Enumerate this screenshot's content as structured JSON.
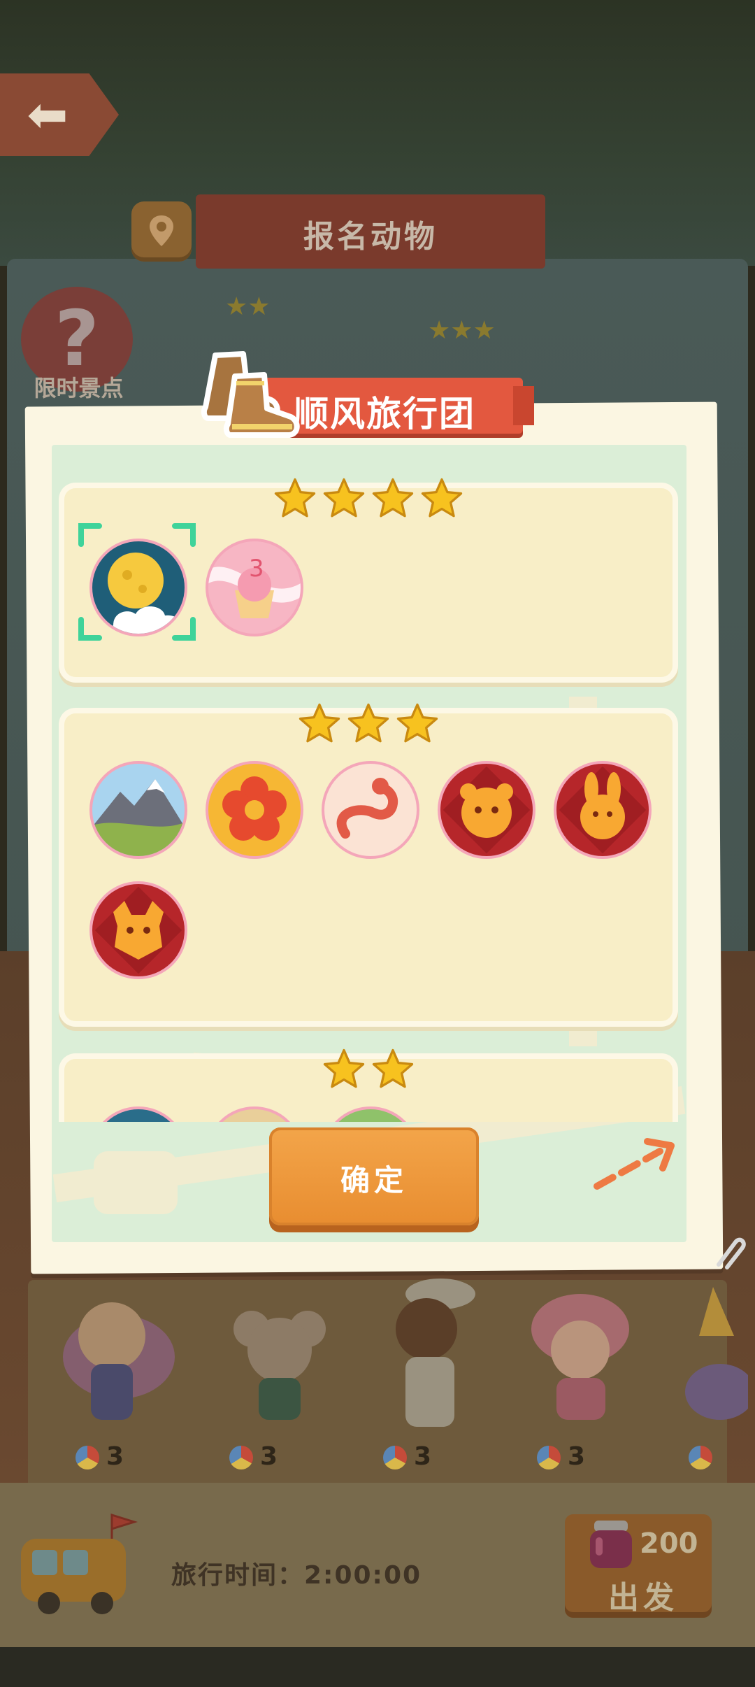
{
  "header": {
    "title": "报名动物"
  },
  "limited_spot": {
    "label": "限时景点"
  },
  "modal": {
    "title": "顺风旅行团",
    "confirm_label": "确定",
    "groups": [
      {
        "stars": 4,
        "spots": [
          "moon-night",
          "cupcake-swirl"
        ]
      },
      {
        "stars": 3,
        "spots": [
          "mountain-meadow",
          "plum-blossom",
          "snake-swirl",
          "tiger-newyear",
          "rabbit-newyear",
          "dragon-newyear"
        ]
      },
      {
        "stars": 2,
        "spots": [
          "partial-spot-1",
          "partial-spot-2",
          "partial-spot-3"
        ]
      }
    ]
  },
  "characters": [
    {
      "name_icon": "unicorn-girl",
      "count": "3"
    },
    {
      "name_icon": "mouse-kid",
      "count": "3"
    },
    {
      "name_icon": "bear-gentleman",
      "count": "3"
    },
    {
      "name_icon": "pink-cake-girl",
      "count": "3"
    },
    {
      "name_icon": "partial-character",
      "count": ""
    }
  ],
  "bottom_bar": {
    "travel_time": "旅行时间：2:00:00",
    "depart_cost": "200",
    "depart_label": "出发"
  },
  "colors": {
    "ribbon": "#e3583f",
    "confirm": "#ef9a3d",
    "card": "#f8eec7",
    "star": "#f7c21f",
    "selection": "#3fd39a"
  }
}
